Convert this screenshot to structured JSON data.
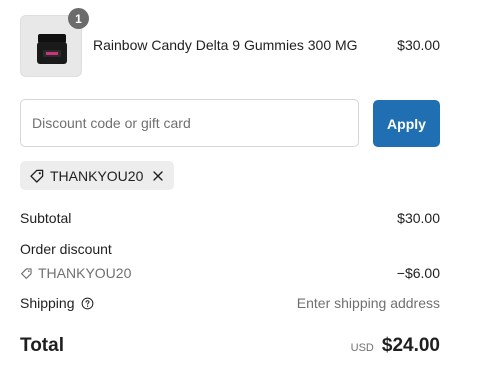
{
  "product": {
    "name": "Rainbow Candy Delta 9 Gummies 300 MG",
    "price": "$30.00",
    "quantity": "1",
    "image_icon": "gummies-jar-thumbnail"
  },
  "discount": {
    "placeholder": "Discount code or gift card",
    "apply_label": "Apply",
    "applied_code": "THANKYOU20"
  },
  "summary": {
    "subtotal_label": "Subtotal",
    "subtotal_value": "$30.00",
    "order_discount_label": "Order discount",
    "order_discount_code": "THANKYOU20",
    "order_discount_value": "−$6.00",
    "shipping_label": "Shipping",
    "shipping_value": "Enter shipping address",
    "total_label": "Total",
    "currency": "USD",
    "total_value": "$24.00"
  },
  "colors": {
    "accent": "#1f6fb2",
    "muted_text": "#707070",
    "chip_bg": "#ededed",
    "badge_bg": "#6b6b6b"
  }
}
